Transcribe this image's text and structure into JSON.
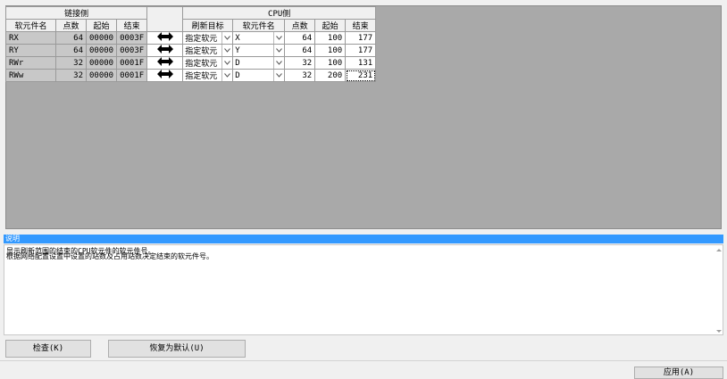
{
  "table": {
    "group_link": "链接侧",
    "group_cpu": "CPU侧",
    "headers": [
      "软元件名",
      "点数",
      "起始",
      "结束",
      "刷新目标",
      "软元件名",
      "点数",
      "起始",
      "结束"
    ],
    "rows": [
      {
        "dev": "RX",
        "pts": "64",
        "start": "00000",
        "end": "0003F",
        "target": "指定软元",
        "cdev": "X",
        "cpts": "64",
        "cstart": "100",
        "cend": "177"
      },
      {
        "dev": "RY",
        "pts": "64",
        "start": "00000",
        "end": "0003F",
        "target": "指定软元",
        "cdev": "Y",
        "cpts": "64",
        "cstart": "100",
        "cend": "177"
      },
      {
        "dev": "RWr",
        "pts": "32",
        "start": "00000",
        "end": "0001F",
        "target": "指定软元",
        "cdev": "D",
        "cpts": "32",
        "cstart": "100",
        "cend": "131"
      },
      {
        "dev": "RWw",
        "pts": "32",
        "start": "00000",
        "end": "0001F",
        "target": "指定软元",
        "cdev": "D",
        "cpts": "32",
        "cstart": "200",
        "cend": "231"
      }
    ]
  },
  "description": {
    "title": "说明",
    "line1": "显示刷新范围的结束的CPU软元件的软元件号。",
    "line2": "根据网络配置设置中设置的站数及占用站数决定结束的软元件号。"
  },
  "buttons": {
    "check": "检查(K)",
    "restore": "恢复为默认(U)",
    "apply": "应用(A)"
  }
}
